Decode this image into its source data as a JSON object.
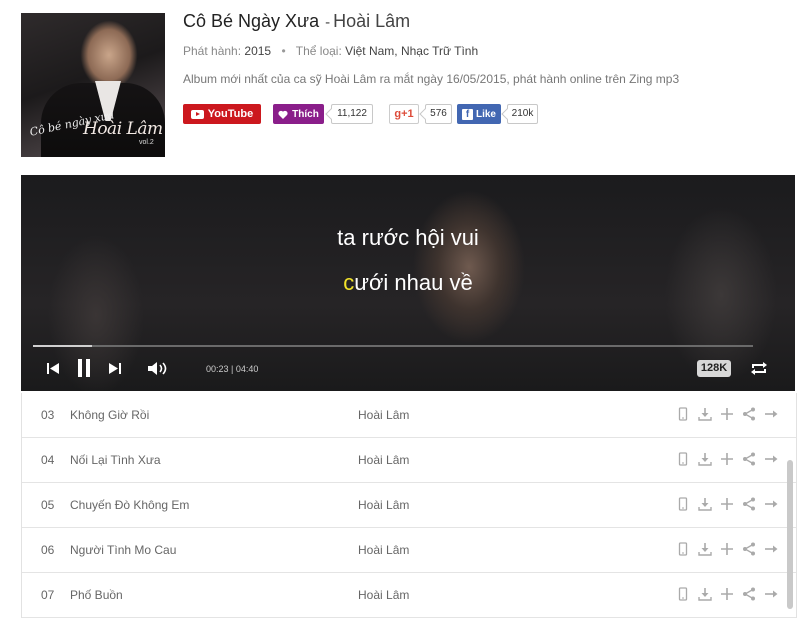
{
  "album": {
    "title": "Cô Bé Ngày Xưa",
    "separator": "-",
    "artist": "Hoài Lâm",
    "release_label": "Phát hành:",
    "release_year": "2015",
    "genre_label": "Thể loại:",
    "genres": "Việt Nam, Nhạc Trữ Tình",
    "description": "Album mới nhất của ca sỹ Hoài Lâm ra mắt ngày 16/05/2015, phát hành online trên Zing mp3",
    "cover_text": {
      "script": "Cô bé ngày xưa",
      "name": "Hoài Lâm",
      "vol": "vol.2"
    }
  },
  "social": {
    "youtube_label": "YouTube",
    "like_label": "Thích",
    "like_count": "11,122",
    "gplus_label": "g+1",
    "gplus_count": "576",
    "fb_label": "Like",
    "fb_count": "210k"
  },
  "player": {
    "lyric_line1": "ta rước hội vui",
    "lyric_line2_highlight": "c",
    "lyric_line2_rest": "ưới nhau về",
    "current_time": "00:23",
    "total_time": "04:40",
    "time_separator": "|",
    "quality": "128K",
    "progress": 0.082,
    "icons": [
      "prev-icon",
      "pause-icon",
      "next-icon",
      "volume-icon",
      "repeat-icon"
    ],
    "colors": {
      "highlight": "#f2e32b",
      "youtube": "#cc181e",
      "like": "#8a1e8a",
      "facebook": "#4267b2"
    }
  },
  "tracks": [
    {
      "num": "03",
      "title": "Không Giờ Rồi",
      "artist": "Hoài Lâm"
    },
    {
      "num": "04",
      "title": "Nối Lại Tình Xưa",
      "artist": "Hoài Lâm"
    },
    {
      "num": "05",
      "title": "Chuyến Đò Không Em",
      "artist": "Hoài Lâm"
    },
    {
      "num": "06",
      "title": "Người Tình Mo Cau",
      "artist": "Hoài Lâm"
    },
    {
      "num": "07",
      "title": "Phố Buồn",
      "artist": "Hoài Lâm"
    }
  ],
  "track_actions": [
    "mobile-icon",
    "download-icon",
    "add-icon",
    "share-icon",
    "forward-icon"
  ]
}
